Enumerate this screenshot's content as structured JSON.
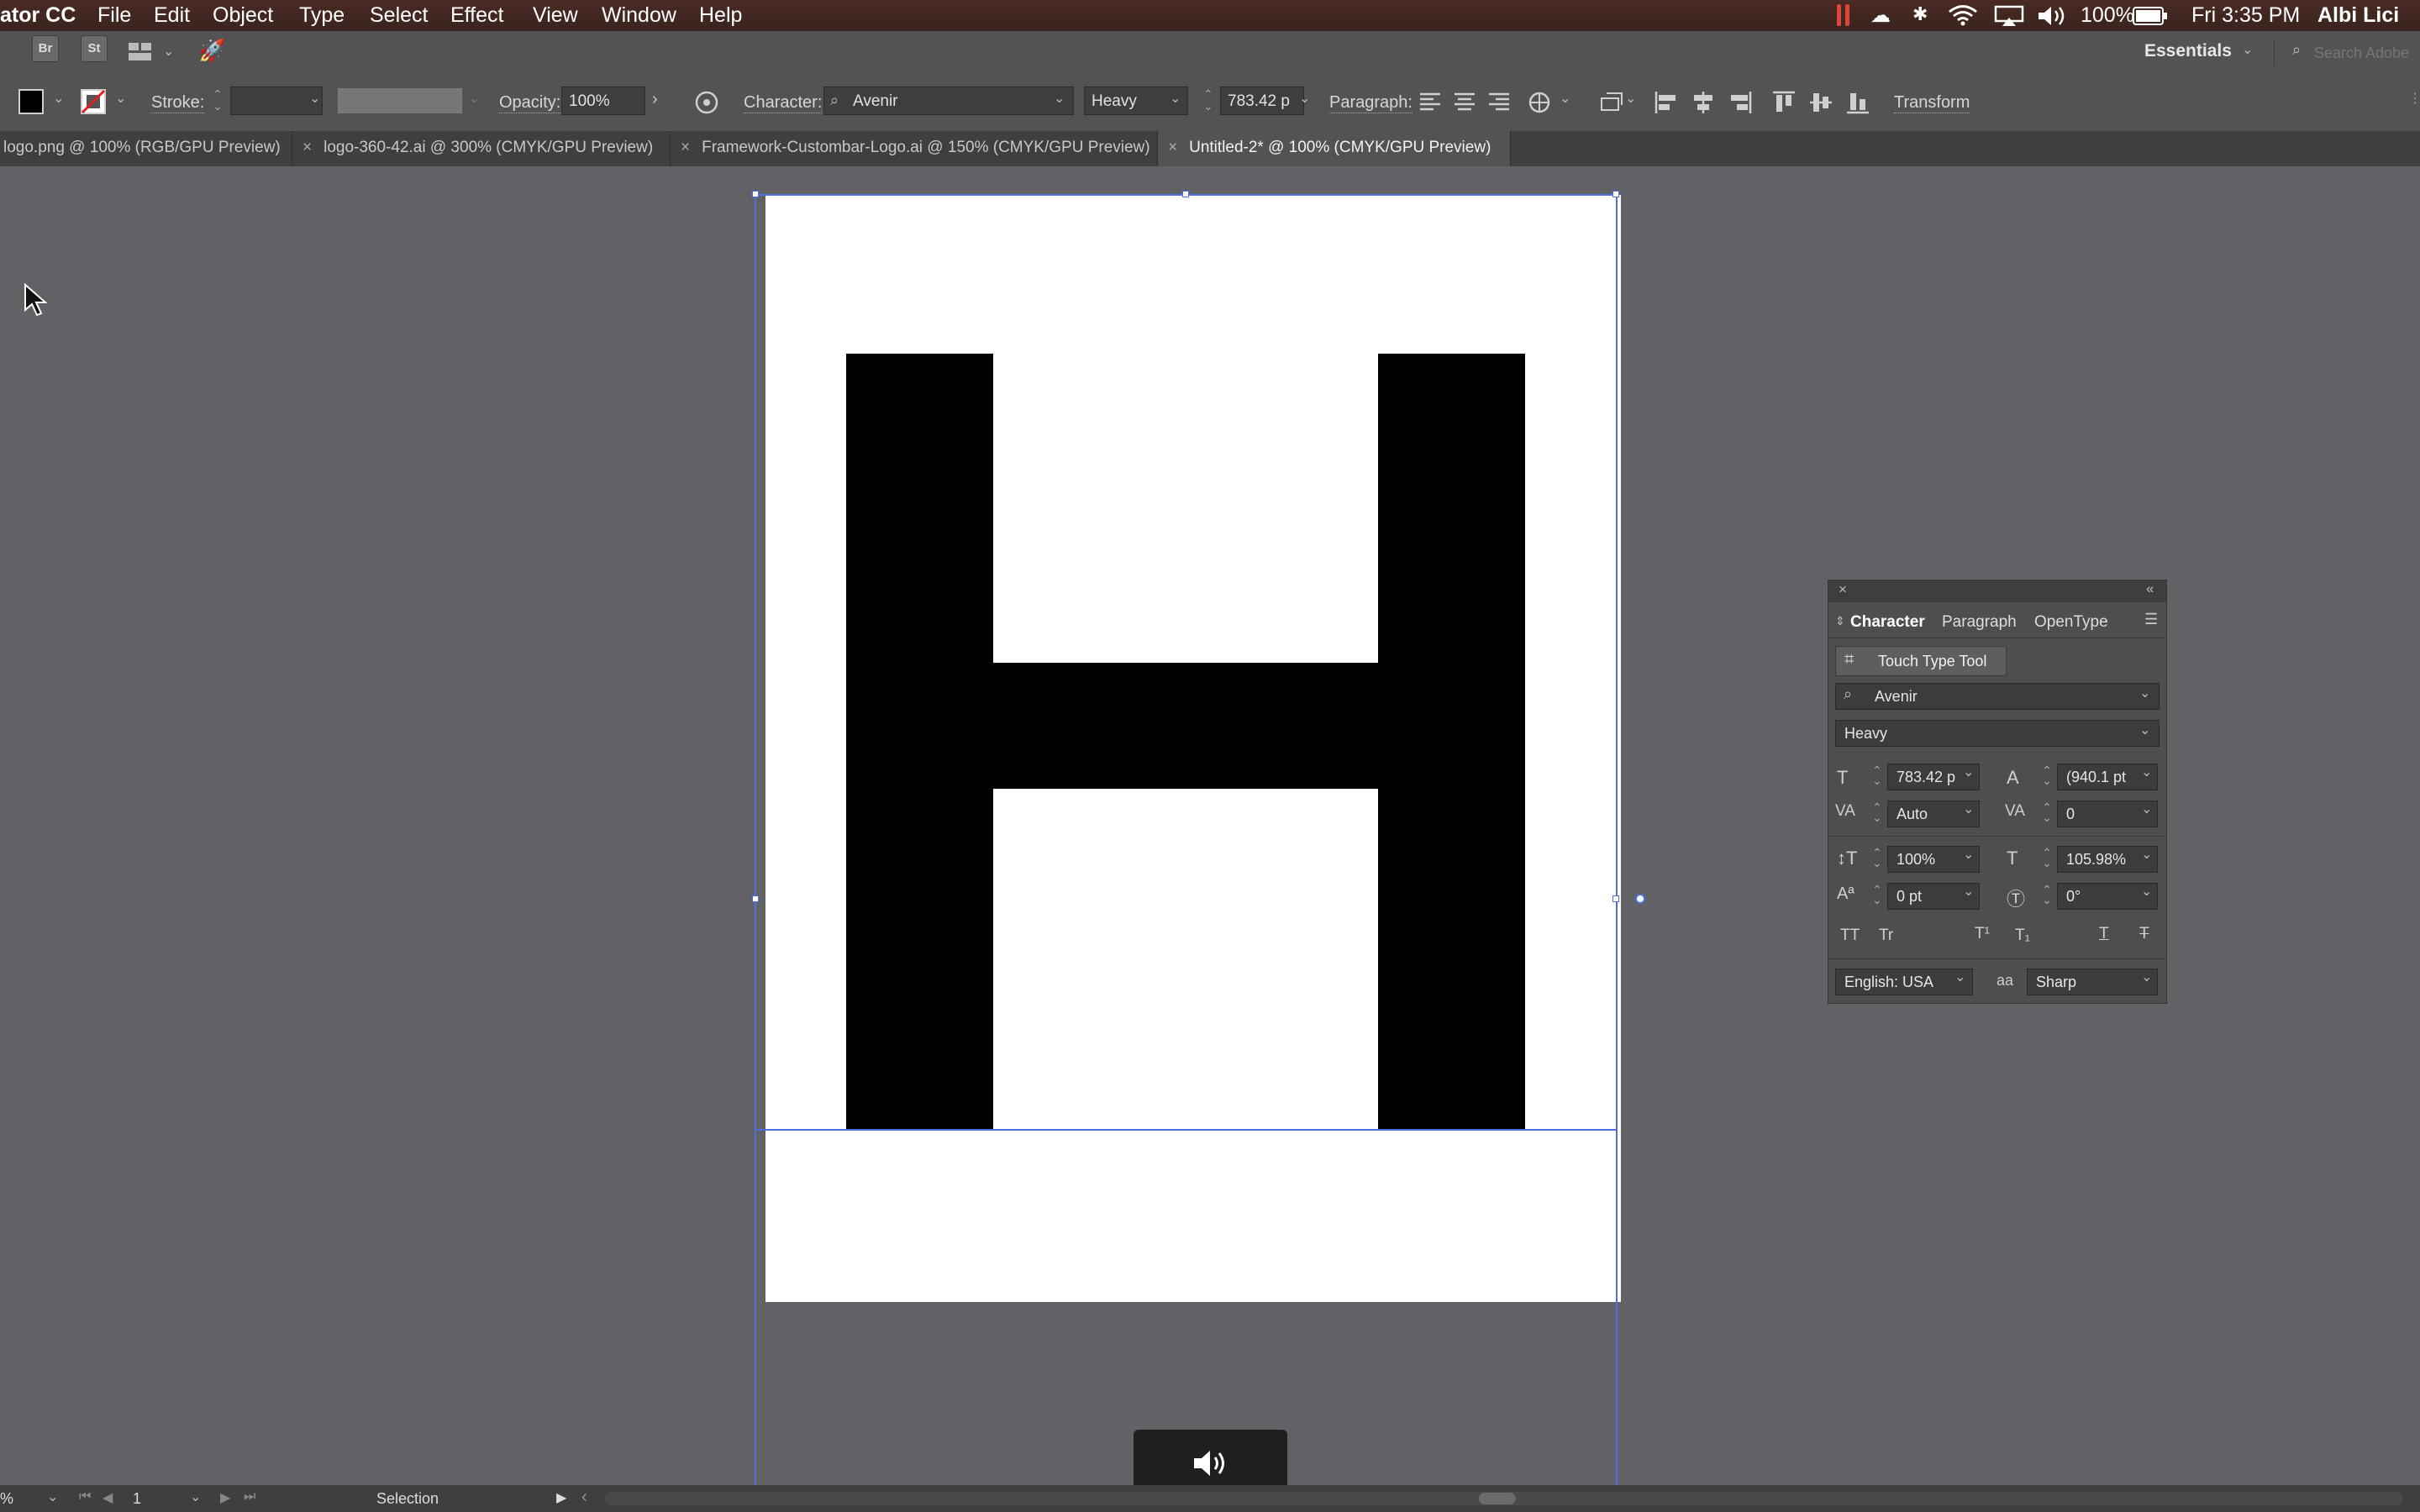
{
  "menubar": {
    "app_name": "ator CC",
    "items": [
      "File",
      "Edit",
      "Object",
      "Type",
      "Select",
      "Effect",
      "View",
      "Window",
      "Help"
    ],
    "battery": "100%",
    "clock": "Fri 3:35 PM",
    "user": "Albi Lici"
  },
  "toprow": {
    "br": "Br",
    "st": "St",
    "workspace": "Essentials",
    "search_placeholder": "Search Adobe"
  },
  "controlbar": {
    "stroke_label": "Stroke:",
    "opacity_label": "Opacity:",
    "opacity_value": "100%",
    "character_label": "Character:",
    "font_family": "Avenir",
    "font_style": "Heavy",
    "font_size": "783.42 p",
    "paragraph_label": "Paragraph:",
    "transform_label": "Transform"
  },
  "tabs": [
    {
      "label": "logo.png @ 100% (RGB/GPU Preview)",
      "active": false
    },
    {
      "label": "logo-360-42.ai @ 300% (CMYK/GPU Preview)",
      "active": false
    },
    {
      "label": "Framework-Custombar-Logo.ai @ 150% (CMYK/GPU Preview)",
      "active": false
    },
    {
      "label": "Untitled-2* @ 100% (CMYK/GPU Preview)",
      "active": true
    }
  ],
  "canvas": {
    "glyph": "H"
  },
  "character_panel": {
    "tabs": [
      "Character",
      "Paragraph",
      "OpenType"
    ],
    "touch_type": "Touch Type Tool",
    "font_family": "Avenir",
    "font_style": "Heavy",
    "font_size": "783.42 p",
    "leading": "(940.1 pt",
    "kerning": "Auto",
    "tracking": "0",
    "vertical_scale": "100%",
    "horizontal_scale": "105.98%",
    "baseline_shift": "0 pt",
    "rotation": "0°",
    "language": "English: USA",
    "antialias": "Sharp",
    "aa_icon": "aa"
  },
  "statusbar": {
    "zoom": "%",
    "artboard": "1",
    "tool": "Selection"
  },
  "colors": {
    "canvas_bg": "#626266",
    "panel_bg": "#535353",
    "selection": "#4d6fe0",
    "glyph_fill": "#000000"
  }
}
